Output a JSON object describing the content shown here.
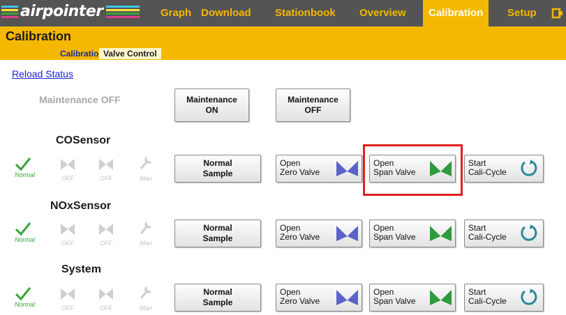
{
  "nav": {
    "logo_text": "airpointer",
    "items": [
      "Graph",
      "Download",
      "Stationbook",
      "Overview",
      "Calibration",
      "Setup"
    ],
    "active": "Calibration"
  },
  "header": {
    "title": "Calibration",
    "subtabs": [
      "Calibration",
      "Valve Control"
    ]
  },
  "reload_label": "Reload Status",
  "maintenance": {
    "status": "Maintenance OFF",
    "on_button": [
      "Maintenance",
      "ON"
    ],
    "off_button": [
      "Maintenance",
      "OFF"
    ]
  },
  "status_labels": {
    "normal": "Normal",
    "off": "OFF",
    "man": "Man"
  },
  "buttons": {
    "normal_sample": [
      "Normal",
      "Sample"
    ],
    "zero_valve": [
      "Open",
      "Zero Valve"
    ],
    "span_valve": [
      "Open",
      "Span Valve"
    ],
    "cali_cycle": [
      "Start",
      "Cali-Cycle"
    ]
  },
  "sections": [
    {
      "title": "COSensor"
    },
    {
      "title": "NOxSensor"
    },
    {
      "title": "System"
    }
  ],
  "colors": {
    "nav_bg": "#545454",
    "accent": "#f5b800",
    "zero_valve": "#5a63c9",
    "span_valve": "#2f9b3c",
    "cycle": "#2a8a9a",
    "highlight": "#e02020"
  }
}
